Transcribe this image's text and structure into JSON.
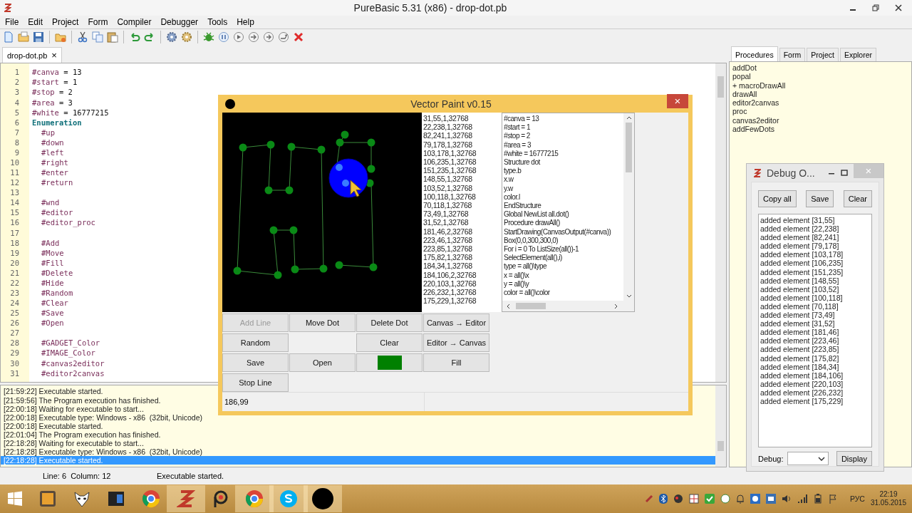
{
  "window": {
    "title": "PureBasic 5.31 (x86) - drop-dot.pb"
  },
  "menu": [
    "File",
    "Edit",
    "Project",
    "Form",
    "Compiler",
    "Debugger",
    "Tools",
    "Help"
  ],
  "file_tabs": [
    {
      "label": "drop-dot.pb",
      "selected": true,
      "close": "×"
    }
  ],
  "editor": {
    "lines": [
      {
        "number": "1",
        "kind": "constant",
        "text": "#canva",
        "value": "= 13"
      },
      {
        "number": "2",
        "kind": "constant",
        "text": "#start",
        "value": "= 1"
      },
      {
        "number": "3",
        "kind": "constant",
        "text": "#stop",
        "value": "= 2"
      },
      {
        "number": "4",
        "kind": "constant",
        "text": "#area",
        "value": "= 3"
      },
      {
        "number": "5",
        "kind": "constant",
        "text": "#white",
        "value": "= 16777215"
      },
      {
        "number": "6",
        "kind": "keyword",
        "text": "Enumeration",
        "children": [
          {
            "number": "7",
            "kind": "constant",
            "text": "#up"
          },
          {
            "number": "8",
            "kind": "constant",
            "text": "#down"
          },
          {
            "number": "9",
            "kind": "constant",
            "text": "#left"
          },
          {
            "number": "10",
            "kind": "constant",
            "text": "#right"
          },
          {
            "number": "11",
            "kind": "constant",
            "text": "#enter"
          },
          {
            "number": "12",
            "kind": "constant",
            "text": "#return"
          },
          {
            "number": "13"
          },
          {
            "number": "14",
            "kind": "constant",
            "text": "#wnd"
          },
          {
            "number": "15",
            "kind": "constant",
            "text": "#editor"
          },
          {
            "number": "16",
            "kind": "constant",
            "text": "#editor_proc"
          },
          {
            "number": "17"
          },
          {
            "number": "18",
            "kind": "constant",
            "text": "#Add"
          },
          {
            "number": "19",
            "kind": "constant",
            "text": "#Move"
          },
          {
            "number": "20",
            "kind": "constant",
            "text": "#Fill"
          },
          {
            "number": "21",
            "kind": "constant",
            "text": "#Delete"
          },
          {
            "number": "22",
            "kind": "constant",
            "text": "#Hide"
          },
          {
            "number": "23",
            "kind": "constant",
            "text": "#Random"
          },
          {
            "number": "24",
            "kind": "constant",
            "text": "#Clear"
          },
          {
            "number": "25",
            "kind": "constant",
            "text": "#Save"
          },
          {
            "number": "26",
            "kind": "constant",
            "text": "#Open"
          },
          {
            "number": "27"
          },
          {
            "number": "28",
            "kind": "constant",
            "text": "#GADGET_Color"
          },
          {
            "number": "29",
            "kind": "constant",
            "text": "#IMAGE_Color"
          },
          {
            "number": "30",
            "kind": "constant",
            "text": "#canvas2editor"
          },
          {
            "number": "31",
            "kind": "constant",
            "text": "#editor2canvas"
          }
        ]
      }
    ]
  },
  "panel_tabs": [
    {
      "label": "Procedures",
      "selected": true
    },
    {
      "label": "Form",
      "selected": false
    },
    {
      "label": "Project",
      "selected": false
    },
    {
      "label": "Explorer",
      "selected": false
    }
  ],
  "procedures": [
    "addDot",
    "popal",
    "+ macroDrawAll",
    "drawAll",
    "editor2canvas",
    "proc",
    "canvas2editor",
    "addFewDots"
  ],
  "log": [
    {
      "text": "[21:59:22] Executable started.",
      "selected": false
    },
    {
      "text": "[21:59:56] The Program execution has finished.",
      "selected": false
    },
    {
      "text": "[22:00:18] Waiting for executable to start...",
      "selected": false
    },
    {
      "text": "[22:00:18] Executable type: Windows - x86  (32bit, Unicode)",
      "selected": false
    },
    {
      "text": "[22:00:18] Executable started.",
      "selected": false
    },
    {
      "text": "[22:01:04] The Program execution has finished.",
      "selected": false
    },
    {
      "text": "[22:18:28] Waiting for executable to start...",
      "selected": false
    },
    {
      "text": "[22:18:28] Executable type: Windows - x86  (32bit, Unicode)",
      "selected": false
    },
    {
      "text": "[22:18:28] Executable started.",
      "selected": true
    }
  ],
  "status_bar": {
    "position": "Line: 6  Column: 12",
    "message": "Executable started."
  },
  "vector_paint": {
    "title": "Vector Paint v0.15",
    "close": "×",
    "dots": [
      "31,55,1,32768",
      "22,238,1,32768",
      "82,241,1,32768",
      "79,178,1,32768",
      "103,178,1,32768",
      "106,235,1,32768",
      "151,235,1,32768",
      "148,55,1,32768",
      "103,52,1,32768",
      "100,118,1,32768",
      "70,118,1,32768",
      "73,49,1,32768",
      "31,52,1,32768",
      "181,46,2,32768",
      "223,46,1,32768",
      "223,85,1,32768",
      "175,82,1,32768",
      "184,34,1,32768",
      "184,106,2,32768",
      "220,103,1,32768",
      "226,232,1,32768",
      "175,229,1,32768"
    ],
    "source": [
      "#canva = 13",
      "#start = 1",
      "#stop = 2",
      "#area = 3",
      "#white = 16777215",
      "Structure dot",
      "type.b",
      "x.w",
      "y.w",
      "color.l",
      "EndStructure",
      "Global NewList all.dot()",
      "Procedure drawAll()",
      "StartDrawing(CanvasOutput(#canva))",
      "Box(0,0,300,300,0)",
      "For i = 0 To ListSize(all())-1",
      "SelectElement(all(),i)",
      "type = all()\\type",
      "x = all()\\x",
      "y = all()\\y",
      "color = all()\\color"
    ],
    "button_rows": [
      [
        {
          "kind": "text",
          "label": "Add Line",
          "disabled": true
        },
        {
          "kind": "text",
          "label": "Move Dot",
          "disabled": false
        },
        {
          "kind": "text",
          "label": "Delete Dot",
          "disabled": false
        },
        {
          "kind": "text",
          "label": "Canvas → Editor",
          "disabled": false
        }
      ],
      [
        {
          "kind": "text",
          "label": "Random",
          "disabled": false
        },
        {
          "kind": "blank"
        },
        {
          "kind": "text",
          "label": "Clear",
          "disabled": false
        },
        {
          "kind": "text",
          "label": "Editor → Canvas",
          "disabled": false
        }
      ],
      [
        {
          "kind": "text",
          "label": "Save",
          "disabled": false
        },
        {
          "kind": "text",
          "label": "Open",
          "disabled": false
        },
        {
          "kind": "color",
          "color": "#008000"
        },
        {
          "kind": "text",
          "label": "Fill",
          "disabled": false
        }
      ],
      [
        {
          "kind": "text",
          "label": "Stop Line",
          "disabled": false
        }
      ]
    ],
    "status": "186,99"
  },
  "debug_output": {
    "title": "Debug O...",
    "close": "×",
    "buttons": [
      "Copy all",
      "Save",
      "Clear"
    ],
    "lines": [
      "added element [31,55]",
      "added element [22,238]",
      "added element [82,241]",
      "added element [79,178]",
      "added element [103,178]",
      "added element [106,235]",
      "added element [151,235]",
      "added element [148,55]",
      "added element [103,52]",
      "added element [100,118]",
      "added element [70,118]",
      "added element [73,49]",
      "added element [31,52]",
      "added element [181,46]",
      "added element [223,46]",
      "added element [223,85]",
      "added element [175,82]",
      "added element [184,34]",
      "added element [184,106]",
      "added element [220,103]",
      "added element [226,232]",
      "added element [175,229]"
    ],
    "debug_label": "Debug:",
    "display_button": "Display"
  },
  "taskbar": {
    "language": "РУС",
    "time": "22:19",
    "date": "31.05.2015"
  }
}
